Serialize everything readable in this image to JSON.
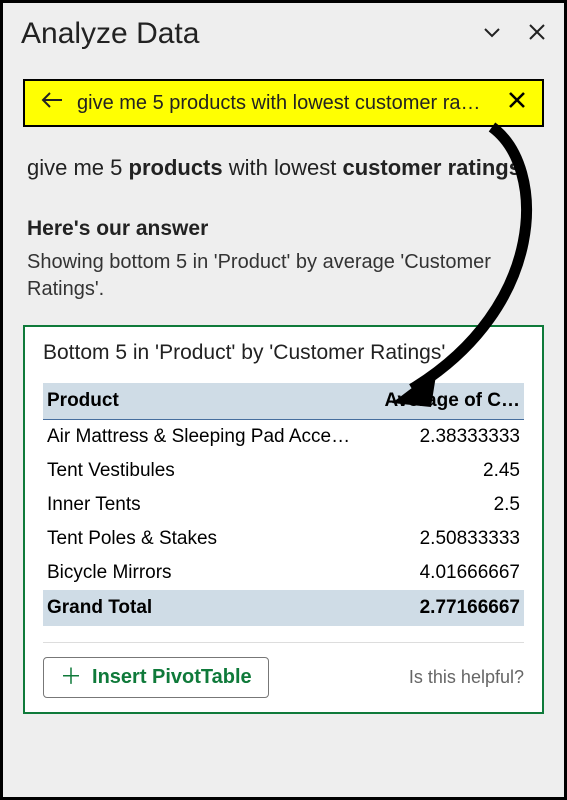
{
  "header": {
    "title": "Analyze Data"
  },
  "query": {
    "truncated_text": "give me 5 products with lowest customer ra…",
    "echo_prefix": "give me 5 ",
    "echo_bold1": "products",
    "echo_mid": " with lowest ",
    "echo_bold2": "customer ratings"
  },
  "answer": {
    "label": "Here's our answer",
    "description": "Showing bottom 5 in 'Product' by average 'Customer Ratings'."
  },
  "card": {
    "title": "Bottom 5 in 'Product' by 'Customer Ratings'",
    "col_product": "Product",
    "col_avg": "Average of C…",
    "rows": [
      {
        "product": "Air Mattress & Sleeping Pad Acce…",
        "value": "2.38333333"
      },
      {
        "product": "Tent Vestibules",
        "value": "2.45"
      },
      {
        "product": "Inner Tents",
        "value": "2.5"
      },
      {
        "product": "Tent Poles & Stakes",
        "value": "2.50833333"
      },
      {
        "product": "Bicycle Mirrors",
        "value": "4.01666667"
      }
    ],
    "grand_total_label": "Grand Total",
    "grand_total_value": "2.77166667",
    "insert_label": "Insert PivotTable",
    "helpful_label": "Is this helpful?"
  }
}
